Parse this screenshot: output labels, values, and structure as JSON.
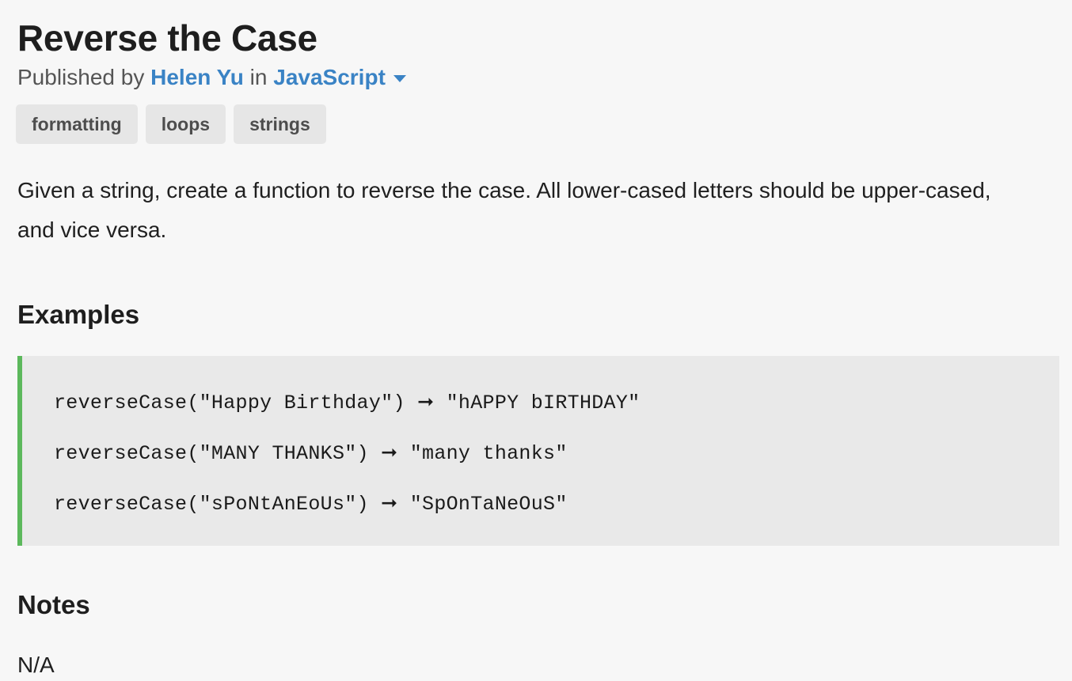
{
  "challenge": {
    "title": "Reverse the Case",
    "published_by_label": "Published by",
    "author": "Helen Yu",
    "in_label": "in",
    "language": "JavaScript",
    "tags": [
      "formatting",
      "loops",
      "strings"
    ],
    "description": "Given a string, create a function to reverse the case. All lower-cased letters should be upper-cased, and vice versa."
  },
  "examples": {
    "heading": "Examples",
    "lines": [
      "reverseCase(\"Happy Birthday\") ➞ \"hAPPY bIRTHDAY\"",
      "reverseCase(\"MANY THANKS\") ➞ \"many thanks\"",
      "reverseCase(\"sPoNtAnEoUs\") ➞ \"SpOnTaNeOuS\""
    ]
  },
  "notes": {
    "heading": "Notes",
    "text": "N/A"
  },
  "colors": {
    "link": "#3a83c5",
    "example_accent": "#5cb85c",
    "background": "#f7f7f7"
  },
  "icons": {
    "language_dropdown": "caret-down-icon"
  }
}
